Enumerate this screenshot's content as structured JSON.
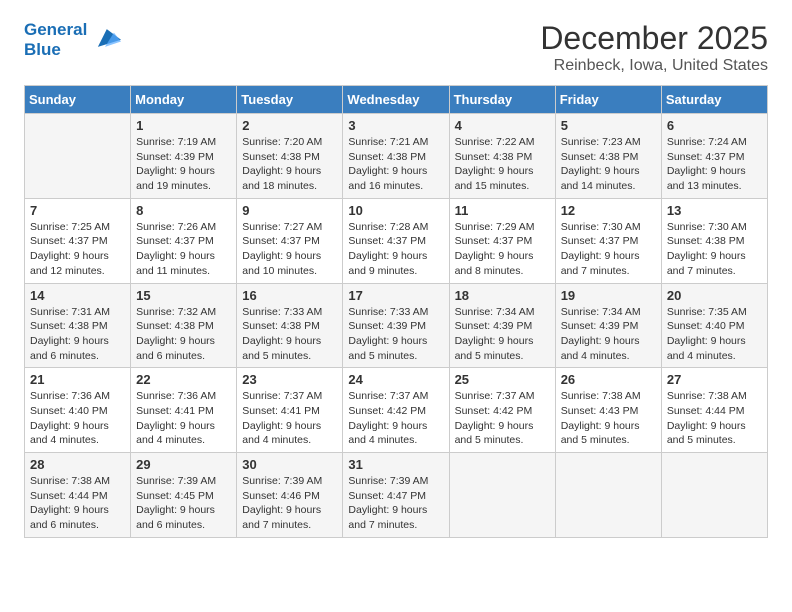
{
  "logo": {
    "line1": "General",
    "line2": "Blue"
  },
  "title": "December 2025",
  "subtitle": "Reinbeck, Iowa, United States",
  "days_of_week": [
    "Sunday",
    "Monday",
    "Tuesday",
    "Wednesday",
    "Thursday",
    "Friday",
    "Saturday"
  ],
  "weeks": [
    [
      {
        "day": "",
        "sunrise": "",
        "sunset": "",
        "daylight": ""
      },
      {
        "day": "1",
        "sunrise": "Sunrise: 7:19 AM",
        "sunset": "Sunset: 4:39 PM",
        "daylight": "Daylight: 9 hours and 19 minutes."
      },
      {
        "day": "2",
        "sunrise": "Sunrise: 7:20 AM",
        "sunset": "Sunset: 4:38 PM",
        "daylight": "Daylight: 9 hours and 18 minutes."
      },
      {
        "day": "3",
        "sunrise": "Sunrise: 7:21 AM",
        "sunset": "Sunset: 4:38 PM",
        "daylight": "Daylight: 9 hours and 16 minutes."
      },
      {
        "day": "4",
        "sunrise": "Sunrise: 7:22 AM",
        "sunset": "Sunset: 4:38 PM",
        "daylight": "Daylight: 9 hours and 15 minutes."
      },
      {
        "day": "5",
        "sunrise": "Sunrise: 7:23 AM",
        "sunset": "Sunset: 4:38 PM",
        "daylight": "Daylight: 9 hours and 14 minutes."
      },
      {
        "day": "6",
        "sunrise": "Sunrise: 7:24 AM",
        "sunset": "Sunset: 4:37 PM",
        "daylight": "Daylight: 9 hours and 13 minutes."
      }
    ],
    [
      {
        "day": "7",
        "sunrise": "Sunrise: 7:25 AM",
        "sunset": "Sunset: 4:37 PM",
        "daylight": "Daylight: 9 hours and 12 minutes."
      },
      {
        "day": "8",
        "sunrise": "Sunrise: 7:26 AM",
        "sunset": "Sunset: 4:37 PM",
        "daylight": "Daylight: 9 hours and 11 minutes."
      },
      {
        "day": "9",
        "sunrise": "Sunrise: 7:27 AM",
        "sunset": "Sunset: 4:37 PM",
        "daylight": "Daylight: 9 hours and 10 minutes."
      },
      {
        "day": "10",
        "sunrise": "Sunrise: 7:28 AM",
        "sunset": "Sunset: 4:37 PM",
        "daylight": "Daylight: 9 hours and 9 minutes."
      },
      {
        "day": "11",
        "sunrise": "Sunrise: 7:29 AM",
        "sunset": "Sunset: 4:37 PM",
        "daylight": "Daylight: 9 hours and 8 minutes."
      },
      {
        "day": "12",
        "sunrise": "Sunrise: 7:30 AM",
        "sunset": "Sunset: 4:37 PM",
        "daylight": "Daylight: 9 hours and 7 minutes."
      },
      {
        "day": "13",
        "sunrise": "Sunrise: 7:30 AM",
        "sunset": "Sunset: 4:38 PM",
        "daylight": "Daylight: 9 hours and 7 minutes."
      }
    ],
    [
      {
        "day": "14",
        "sunrise": "Sunrise: 7:31 AM",
        "sunset": "Sunset: 4:38 PM",
        "daylight": "Daylight: 9 hours and 6 minutes."
      },
      {
        "day": "15",
        "sunrise": "Sunrise: 7:32 AM",
        "sunset": "Sunset: 4:38 PM",
        "daylight": "Daylight: 9 hours and 6 minutes."
      },
      {
        "day": "16",
        "sunrise": "Sunrise: 7:33 AM",
        "sunset": "Sunset: 4:38 PM",
        "daylight": "Daylight: 9 hours and 5 minutes."
      },
      {
        "day": "17",
        "sunrise": "Sunrise: 7:33 AM",
        "sunset": "Sunset: 4:39 PM",
        "daylight": "Daylight: 9 hours and 5 minutes."
      },
      {
        "day": "18",
        "sunrise": "Sunrise: 7:34 AM",
        "sunset": "Sunset: 4:39 PM",
        "daylight": "Daylight: 9 hours and 5 minutes."
      },
      {
        "day": "19",
        "sunrise": "Sunrise: 7:34 AM",
        "sunset": "Sunset: 4:39 PM",
        "daylight": "Daylight: 9 hours and 4 minutes."
      },
      {
        "day": "20",
        "sunrise": "Sunrise: 7:35 AM",
        "sunset": "Sunset: 4:40 PM",
        "daylight": "Daylight: 9 hours and 4 minutes."
      }
    ],
    [
      {
        "day": "21",
        "sunrise": "Sunrise: 7:36 AM",
        "sunset": "Sunset: 4:40 PM",
        "daylight": "Daylight: 9 hours and 4 minutes."
      },
      {
        "day": "22",
        "sunrise": "Sunrise: 7:36 AM",
        "sunset": "Sunset: 4:41 PM",
        "daylight": "Daylight: 9 hours and 4 minutes."
      },
      {
        "day": "23",
        "sunrise": "Sunrise: 7:37 AM",
        "sunset": "Sunset: 4:41 PM",
        "daylight": "Daylight: 9 hours and 4 minutes."
      },
      {
        "day": "24",
        "sunrise": "Sunrise: 7:37 AM",
        "sunset": "Sunset: 4:42 PM",
        "daylight": "Daylight: 9 hours and 4 minutes."
      },
      {
        "day": "25",
        "sunrise": "Sunrise: 7:37 AM",
        "sunset": "Sunset: 4:42 PM",
        "daylight": "Daylight: 9 hours and 5 minutes."
      },
      {
        "day": "26",
        "sunrise": "Sunrise: 7:38 AM",
        "sunset": "Sunset: 4:43 PM",
        "daylight": "Daylight: 9 hours and 5 minutes."
      },
      {
        "day": "27",
        "sunrise": "Sunrise: 7:38 AM",
        "sunset": "Sunset: 4:44 PM",
        "daylight": "Daylight: 9 hours and 5 minutes."
      }
    ],
    [
      {
        "day": "28",
        "sunrise": "Sunrise: 7:38 AM",
        "sunset": "Sunset: 4:44 PM",
        "daylight": "Daylight: 9 hours and 6 minutes."
      },
      {
        "day": "29",
        "sunrise": "Sunrise: 7:39 AM",
        "sunset": "Sunset: 4:45 PM",
        "daylight": "Daylight: 9 hours and 6 minutes."
      },
      {
        "day": "30",
        "sunrise": "Sunrise: 7:39 AM",
        "sunset": "Sunset: 4:46 PM",
        "daylight": "Daylight: 9 hours and 7 minutes."
      },
      {
        "day": "31",
        "sunrise": "Sunrise: 7:39 AM",
        "sunset": "Sunset: 4:47 PM",
        "daylight": "Daylight: 9 hours and 7 minutes."
      },
      {
        "day": "",
        "sunrise": "",
        "sunset": "",
        "daylight": ""
      },
      {
        "day": "",
        "sunrise": "",
        "sunset": "",
        "daylight": ""
      },
      {
        "day": "",
        "sunrise": "",
        "sunset": "",
        "daylight": ""
      }
    ]
  ]
}
